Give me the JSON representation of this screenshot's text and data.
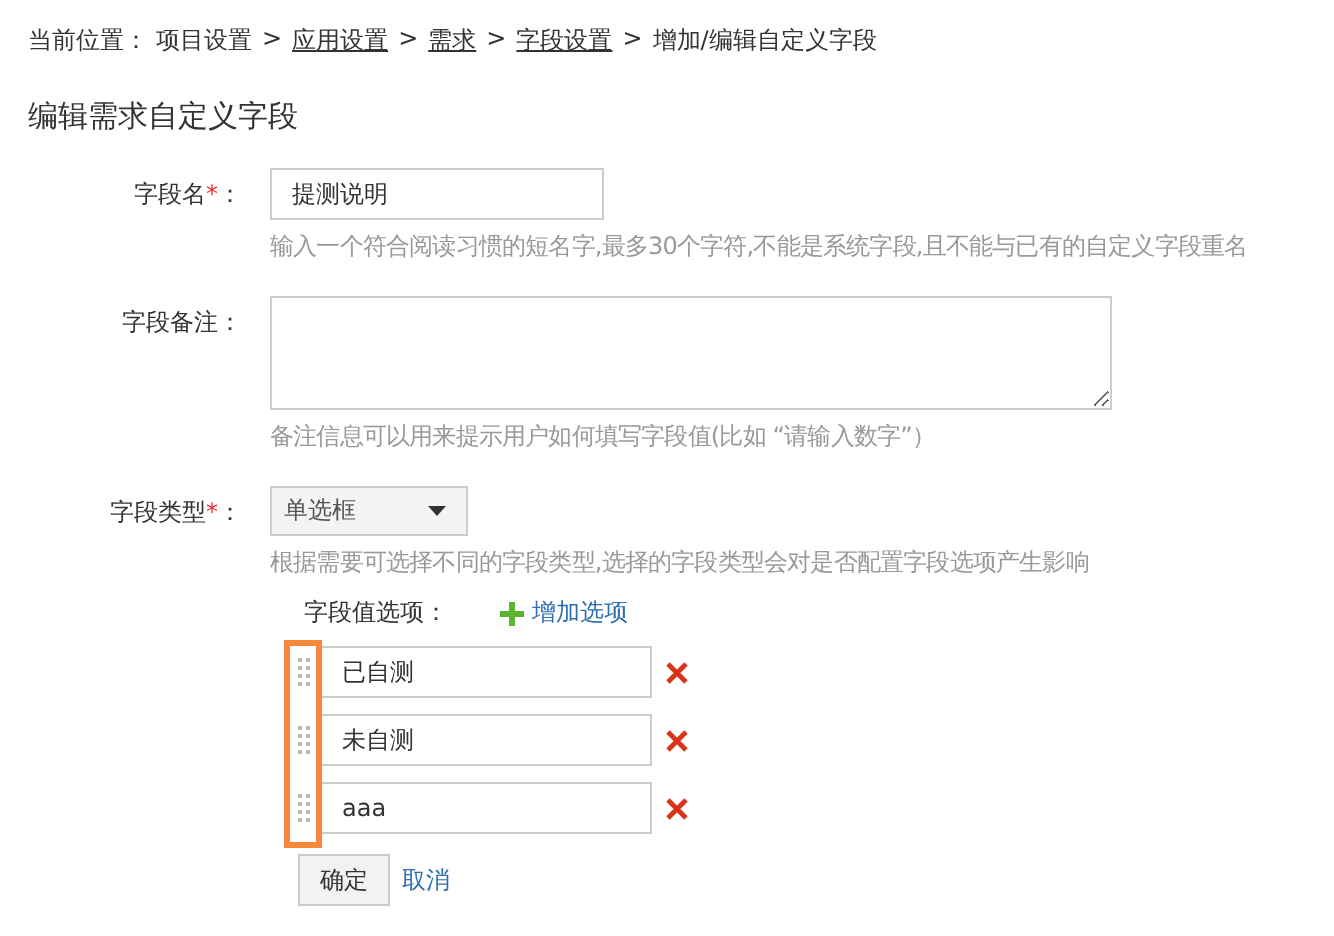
{
  "breadcrumb": {
    "prefix": "当前位置：",
    "items": [
      {
        "label": "项目设置",
        "kind": "text"
      },
      {
        "label": "应用设置",
        "kind": "link"
      },
      {
        "label": "需求",
        "kind": "link"
      },
      {
        "label": "字段设置",
        "kind": "link"
      },
      {
        "label": "增加/编辑自定义字段",
        "kind": "text"
      }
    ],
    "separator": ">"
  },
  "page_title": "编辑需求自定义字段",
  "required_mark": "*",
  "label_suffix": "：",
  "fields": [
    {
      "kind": "input",
      "label": "字段名",
      "required": true,
      "value": "提测说明",
      "hint": "输入一个符合阅读习惯的短名字,最多30个字符,不能是系统字段,且不能与已有的自定义字段重名"
    },
    {
      "kind": "textarea",
      "label": "字段备注",
      "required": false,
      "hint": "备注信息可以用来提示用户如何填写字段值(比如 “请输入数字”）"
    },
    {
      "kind": "select",
      "label": "字段类型",
      "required": true,
      "value": "单选框",
      "hint": "根据需要可选择不同的字段类型,选择的字段类型会对是否配置字段选项产生影响"
    }
  ],
  "options": {
    "label": "字段值选项：",
    "add_label": "增加选项",
    "items": [
      {
        "value": "已自测"
      },
      {
        "value": "未自测"
      },
      {
        "value": "aaa"
      }
    ]
  },
  "buttons": {
    "confirm": "确定",
    "cancel": "取消"
  }
}
